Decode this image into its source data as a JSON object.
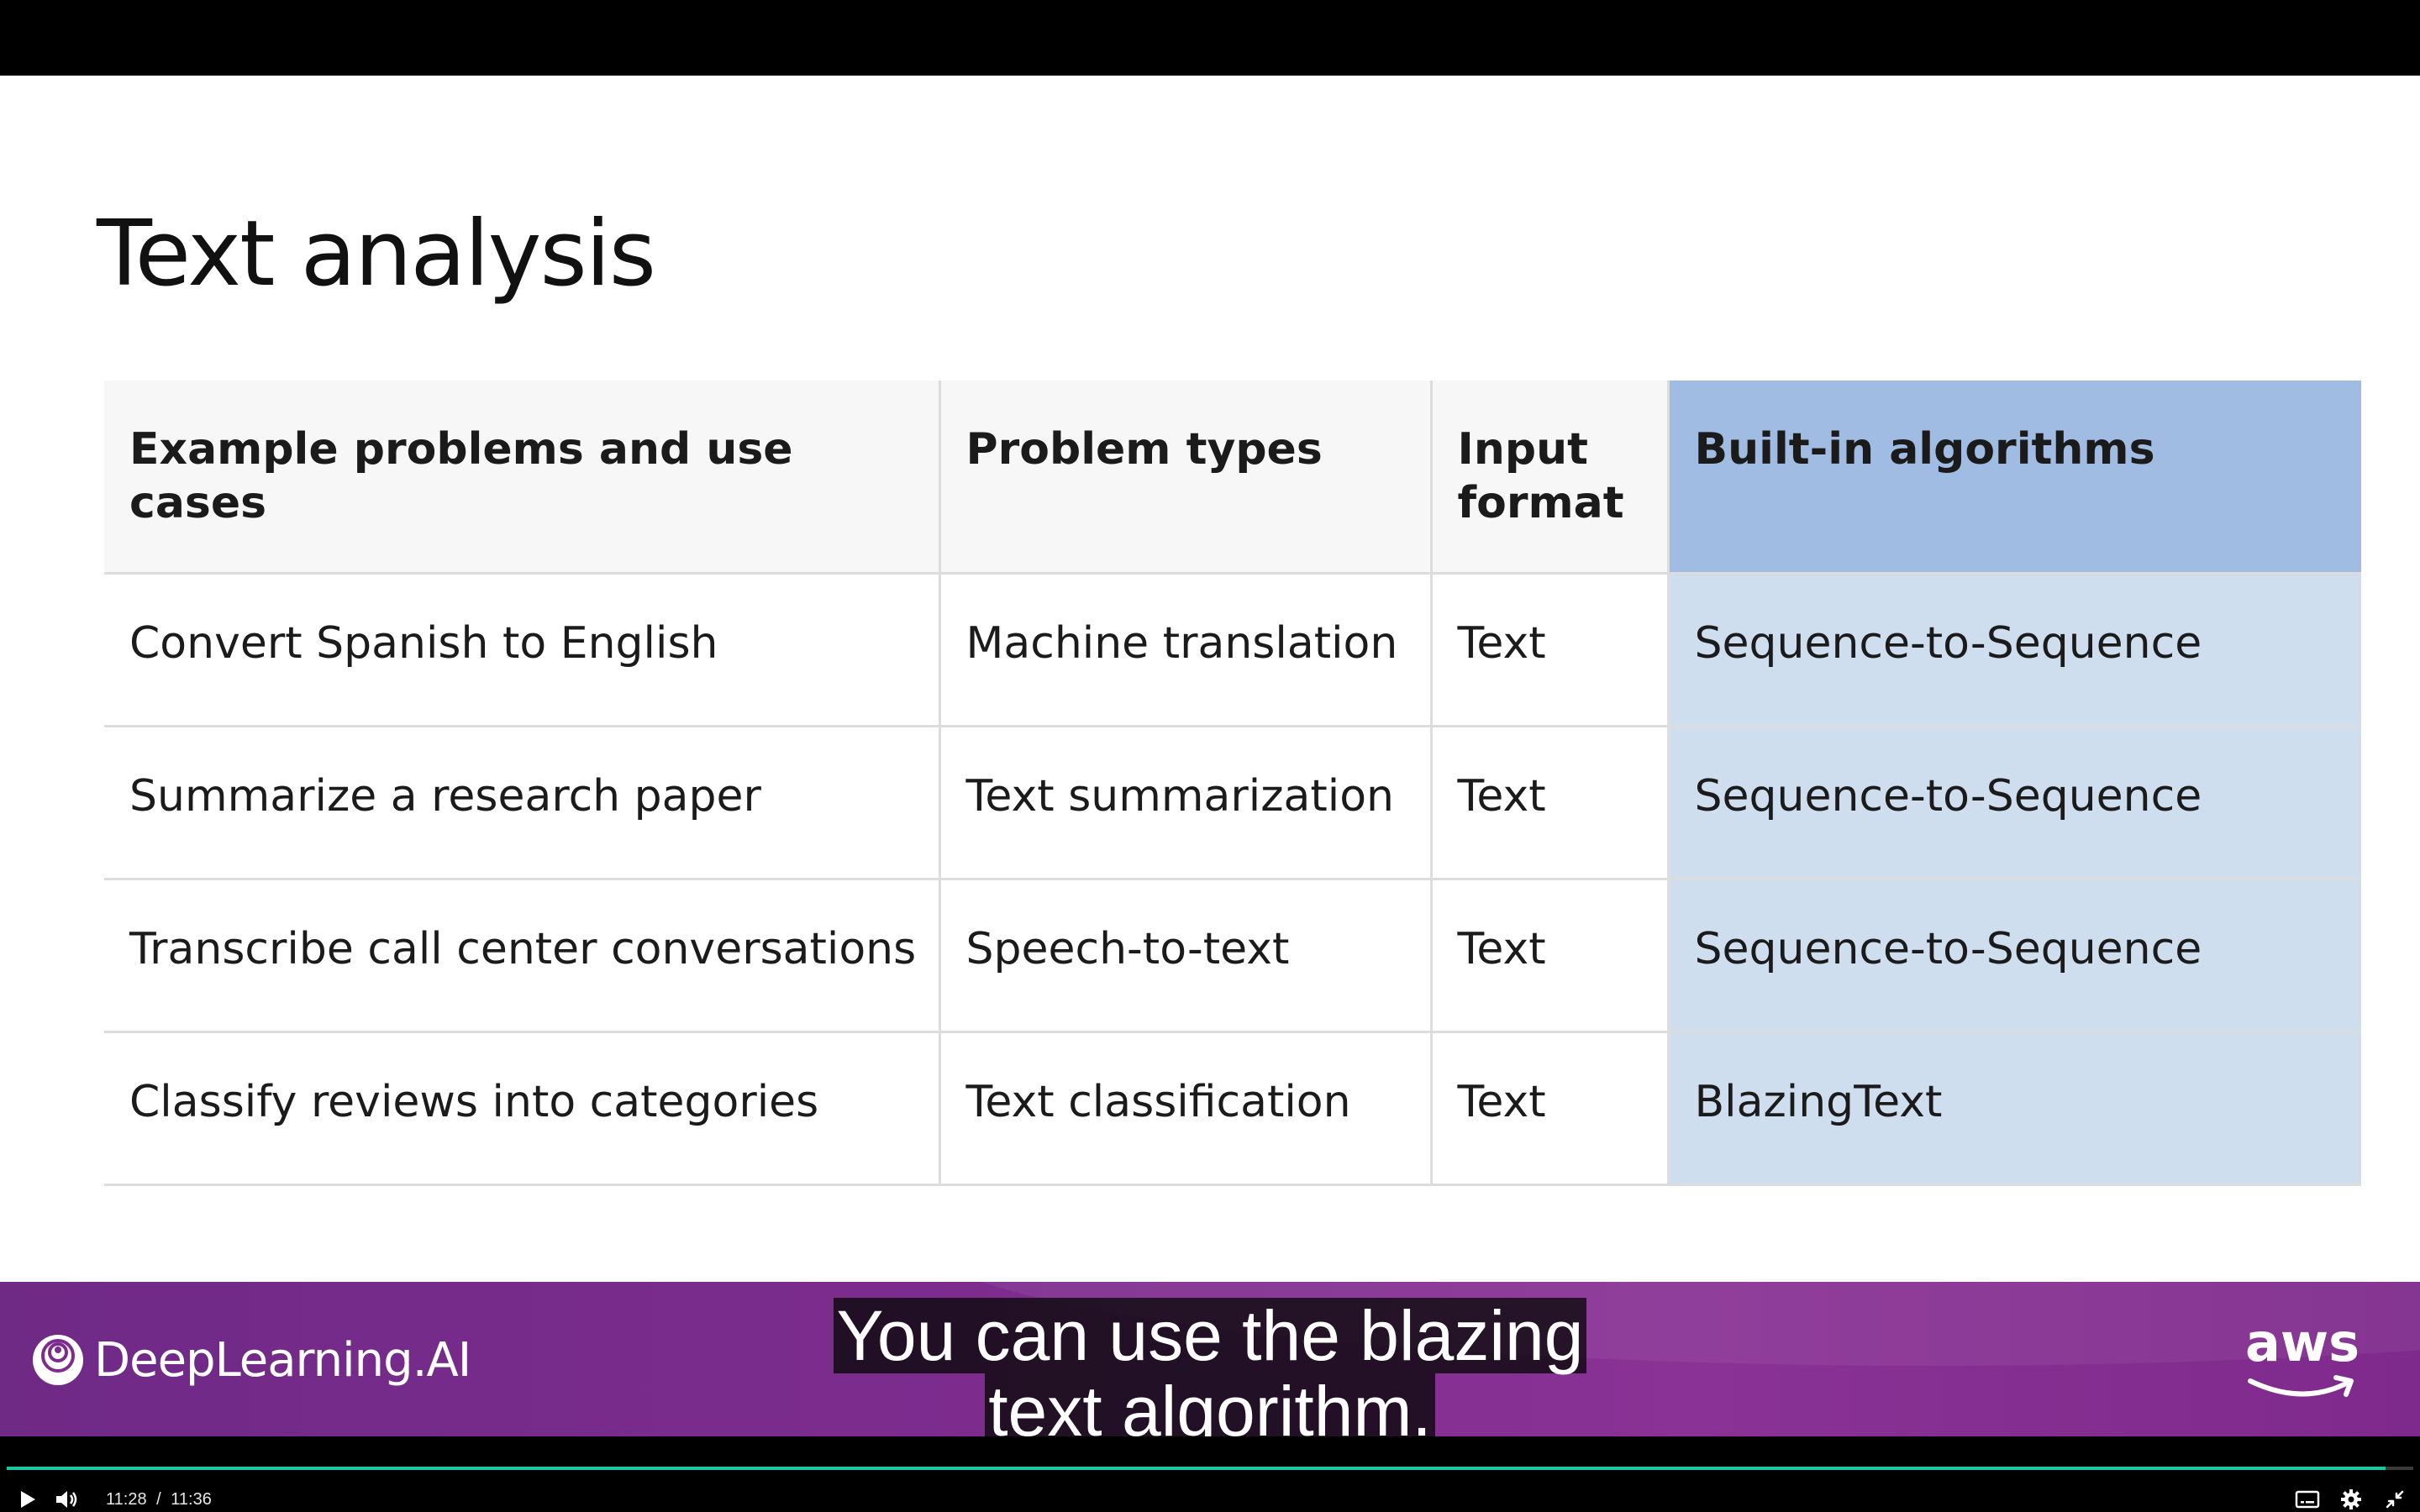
{
  "slide": {
    "title": "Text analysis",
    "table": {
      "headers": [
        [
          "Example problems and use cases"
        ],
        [
          "Problem types"
        ],
        [
          "Input",
          "format"
        ],
        [
          "Built-in algorithms"
        ]
      ],
      "rows": [
        [
          "Convert Spanish to English",
          "Machine translation",
          "Text",
          "Sequence-to-Sequence"
        ],
        [
          "Summarize a research paper",
          "Text summarization",
          "Text",
          "Sequence-to-Sequence"
        ],
        [
          "Transcribe call center conversations",
          "Speech-to-text",
          "Text",
          "Sequence-to-Sequence"
        ],
        [
          "Classify reviews into categories",
          "Text classification",
          "Text",
          "BlazingText"
        ]
      ],
      "highlight_color": "#a0bce2",
      "highlight_cell_color": "#cfdeef"
    }
  },
  "banner": {
    "brand_name": "DeepLearning.AI",
    "partner_logo": "aws",
    "gradient_color": "#7d2c8e"
  },
  "captions": {
    "lines": [
      "You can use the blazing",
      "text algorithm."
    ]
  },
  "player": {
    "current_time": "11:28",
    "separator": "/",
    "duration": "11:36",
    "progress": 0.9885,
    "accent_color": "#1bc6a4",
    "icons": [
      "play-icon",
      "volume-icon",
      "captions-icon",
      "settings-icon",
      "exit-fullscreen-icon"
    ]
  }
}
